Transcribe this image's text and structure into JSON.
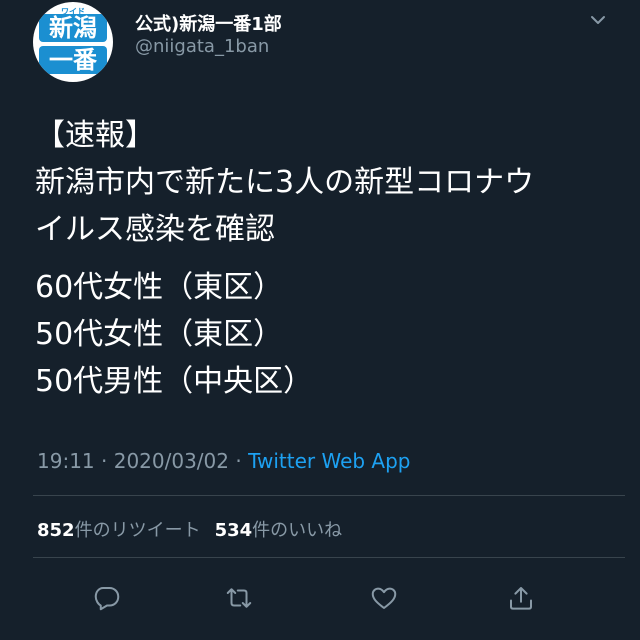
{
  "profile": {
    "avatar_text_top": "新潟",
    "avatar_text_bottom": "一番",
    "avatar_kana": "ワイド",
    "display_name": "公式)新潟一番1部",
    "handle": "@niigata_1ban"
  },
  "tweet": {
    "lines": [
      "【速報】",
      "新潟市内で新たに3人の新型コロナウ",
      "イルス感染を確認",
      "60代女性（東区）",
      "50代女性（東区）",
      "50代男性（中央区）"
    ],
    "time": "19:11",
    "date": "2020/03/02",
    "separator": "·",
    "source": "Twitter Web App"
  },
  "stats": {
    "retweets": "852",
    "retweets_label": "件のリツイート",
    "likes": "534",
    "likes_label": "件のいいね"
  },
  "actions": {
    "icons": [
      "reply-icon",
      "retweet-icon",
      "like-icon",
      "share-icon"
    ]
  },
  "colors": {
    "background": "#15202b",
    "text": "#ffffff",
    "secondary": "#8899a6",
    "link": "#1da1f2",
    "divider": "#38444d"
  }
}
